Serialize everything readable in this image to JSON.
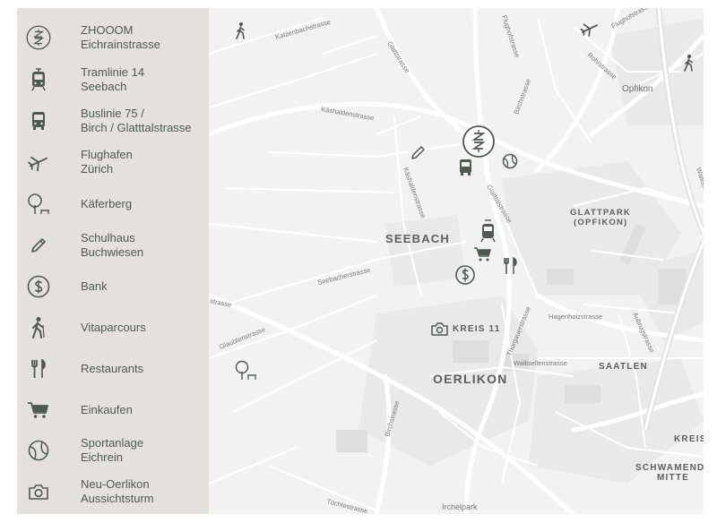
{
  "legend": {
    "items": [
      {
        "icon": "zhooom-logo-icon",
        "line1": "ZHOOOM",
        "line2": "Eichrainstrasse"
      },
      {
        "icon": "tram-icon",
        "line1": "Tramlinie 14",
        "line2": "Seebach"
      },
      {
        "icon": "bus-icon",
        "line1": "Buslinie 75 /",
        "line2": "Birch / Glatttalstrasse"
      },
      {
        "icon": "airplane-icon",
        "line1": "Flughafen",
        "line2": "Zürich"
      },
      {
        "icon": "tree-bench-icon",
        "line1": "Käferberg",
        "line2": ""
      },
      {
        "icon": "pencil-icon",
        "line1": "Schulhaus",
        "line2": "Buchwiesen"
      },
      {
        "icon": "dollar-icon",
        "line1": "Bank",
        "line2": ""
      },
      {
        "icon": "hiker-icon",
        "line1": "Vitaparcours",
        "line2": ""
      },
      {
        "icon": "fork-knife-icon",
        "line1": "Restaurants",
        "line2": ""
      },
      {
        "icon": "shopping-cart-icon",
        "line1": "Einkaufen",
        "line2": ""
      },
      {
        "icon": "tennis-ball-icon",
        "line1": "Sportanlage",
        "line2": "Eichrein"
      },
      {
        "icon": "camera-icon",
        "line1": "Neu-Oerlikon",
        "line2": "Aussichtsturm"
      }
    ]
  },
  "map": {
    "areas": {
      "seebach": "SEEBACH",
      "oerlikon": "OERLIKON",
      "kreis11": "KREIS 11",
      "glattpark1": "GLATTPARK",
      "glattpark2": "(OPFIKON)",
      "saatlen": "SAATLEN",
      "schwamendingen1": "SCHWAMENDIN",
      "schwamendingen2": "MITTE",
      "opfikon": "Opfikon",
      "kreis_edge": "KREIS",
      "irchelpark": "Irchelpark"
    },
    "streets": {
      "katzenbach": "Katzenbachstrasse",
      "flughof": "Flughofstrasse",
      "glattstrasse": "Glattstrasse",
      "rohr": "Rohrstrasse",
      "flughof2": "Flughofstrasse",
      "birchstrasse_top": "Birchstrasse",
      "kaeshalden": "Käshaldenstrasse",
      "kaeshalden2": "Käshaldenstrasse",
      "glatttal": "Glatttalstrasse",
      "seebacher": "Seebacherstrasse",
      "strasse_left": "strasse",
      "glaubten": "Glaubtenstrasse",
      "thurgauer": "Thurgauerstrasse",
      "thurgauer2": "Thurgauerstrasse",
      "hagenholz": "Hagenholzstrasse",
      "aubrug": "Aubrugstrasse",
      "wallisellen": "Wallisellenstrasse",
      "wallisellen_edge": "Wallisellen",
      "birchstrasse_low": "Birchstrasse",
      "tiefen": "Tiefenbrunnen",
      "toechter": "Töchtestrasse"
    }
  },
  "colors": {
    "legend_bg": "#e4e1dc",
    "icon": "#4e5a50",
    "map_bg": "#f2f2f2",
    "road": "#ffffff",
    "label": "#5e5e5e"
  }
}
